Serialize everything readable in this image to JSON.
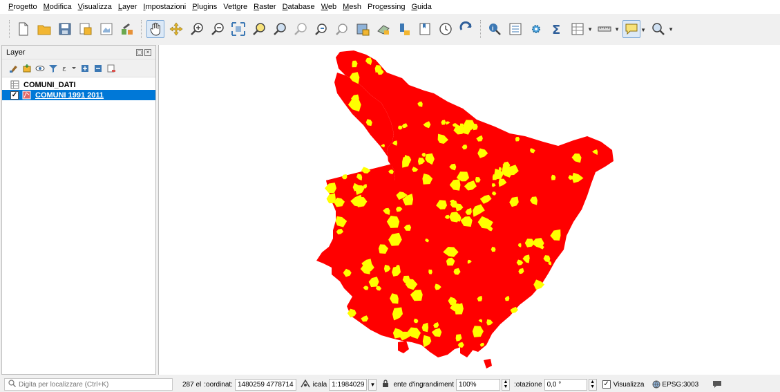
{
  "menu": {
    "items": [
      {
        "pre": "",
        "u": "P",
        "post": "rogetto"
      },
      {
        "pre": "",
        "u": "M",
        "post": "odifica"
      },
      {
        "pre": "",
        "u": "V",
        "post": "isualizza"
      },
      {
        "pre": "",
        "u": "L",
        "post": "ayer"
      },
      {
        "pre": "",
        "u": "I",
        "post": "mpostazioni"
      },
      {
        "pre": "",
        "u": "P",
        "post": "lugins"
      },
      {
        "pre": "Vett",
        "u": "o",
        "post": "re"
      },
      {
        "pre": "",
        "u": "R",
        "post": "aster"
      },
      {
        "pre": "",
        "u": "D",
        "post": "atabase"
      },
      {
        "pre": "",
        "u": "W",
        "post": "eb"
      },
      {
        "pre": "",
        "u": "M",
        "post": "esh"
      },
      {
        "pre": "Pro",
        "u": "c",
        "post": "essing"
      },
      {
        "pre": "",
        "u": "G",
        "post": "uida"
      }
    ]
  },
  "layers_panel": {
    "title": "Layer",
    "items": [
      {
        "name": "COMUNI_DATI",
        "checked": false,
        "selected": false
      },
      {
        "name": "COMUNI 1991 2011",
        "checked": true,
        "selected": true
      }
    ]
  },
  "map": {
    "fill_color": "#ff0000",
    "highlight_color": "#ffff00"
  },
  "statusbar": {
    "locator_placeholder": "Digita per localizzare (Ctrl+K)",
    "count": "287 el",
    "coord_label": ":oordinat:",
    "coord_value": "1480259 4778714",
    "scale_label": "icala",
    "scale_value": "1:1984029",
    "magnifier_label": "ente d'ingrandiment",
    "magnifier_value": "100%",
    "rotation_label": ":otazione",
    "rotation_value": "0,0 °",
    "render_label": "Visualizza",
    "render_checked": "✓",
    "crs": "EPSG:3003"
  }
}
